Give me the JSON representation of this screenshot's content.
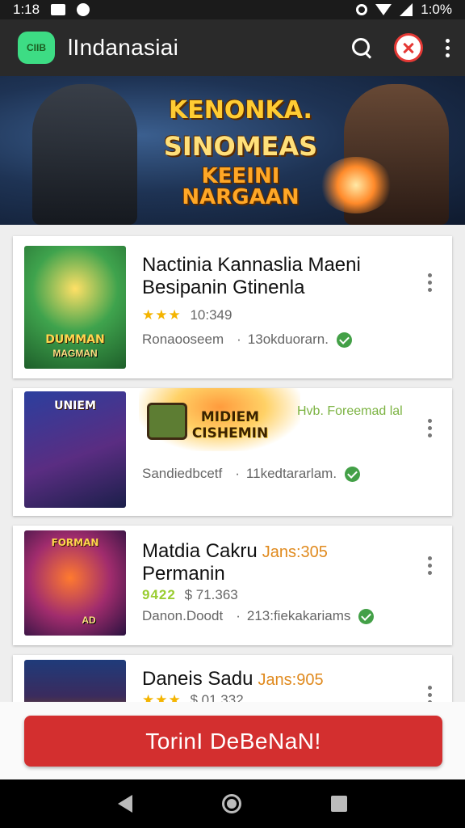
{
  "status_bar": {
    "time": "1:18",
    "battery": "1:0%"
  },
  "app_bar": {
    "logo_text": "CIIB",
    "title": "lIndanasiai"
  },
  "banner": {
    "line1": "KENONKA.",
    "line2": "SINOMEAS",
    "line3": "KEEINI NARGAAN"
  },
  "games": [
    {
      "title_line1": "Nactinia Kannaslia Maeni",
      "title_line2": "Besipanin Gtinenla",
      "tag": "",
      "rating": "10:349",
      "stars": "★★★",
      "meta_left": "Ronaooseem",
      "meta_right": "13okduorarn.",
      "thumb_text": "DUMMAN",
      "thumb_label": "MAGMAN"
    },
    {
      "title_line1": "",
      "title_line2": "",
      "tag": "",
      "rating": "",
      "stars": "",
      "meta_left": "Sandiedbcetf",
      "meta_right": "11kedtararlam.",
      "thumb_text": "UNIEM",
      "thumb_label": "",
      "promo_title": "MIDIEM CISHEMIN",
      "promo_text": "Hvb. Foreemad lal"
    },
    {
      "title_line1": "Matdia Cakru",
      "title_line2": "Permanin",
      "tag": "Jans:305",
      "rating": "71.363",
      "stars": "9422",
      "meta_left": "Danon.Doodt",
      "meta_right": "213:fiekakariams",
      "thumb_text": "FORMAN",
      "thumb_label": "AD"
    },
    {
      "title_line1": "Daneis Sadu",
      "title_line2": "",
      "tag": "Jans:905",
      "rating": "01.332",
      "stars": "★★★",
      "meta_left": "",
      "meta_right": "",
      "thumb_text": "",
      "thumb_label": ""
    }
  ],
  "cta": {
    "label": "TorinI DeBeNaN!"
  },
  "colors": {
    "accent": "#d32f2f",
    "appbar": "#2a2a2a",
    "logo": "#3ddc84",
    "star": "#f4b400",
    "check": "#43a047"
  }
}
